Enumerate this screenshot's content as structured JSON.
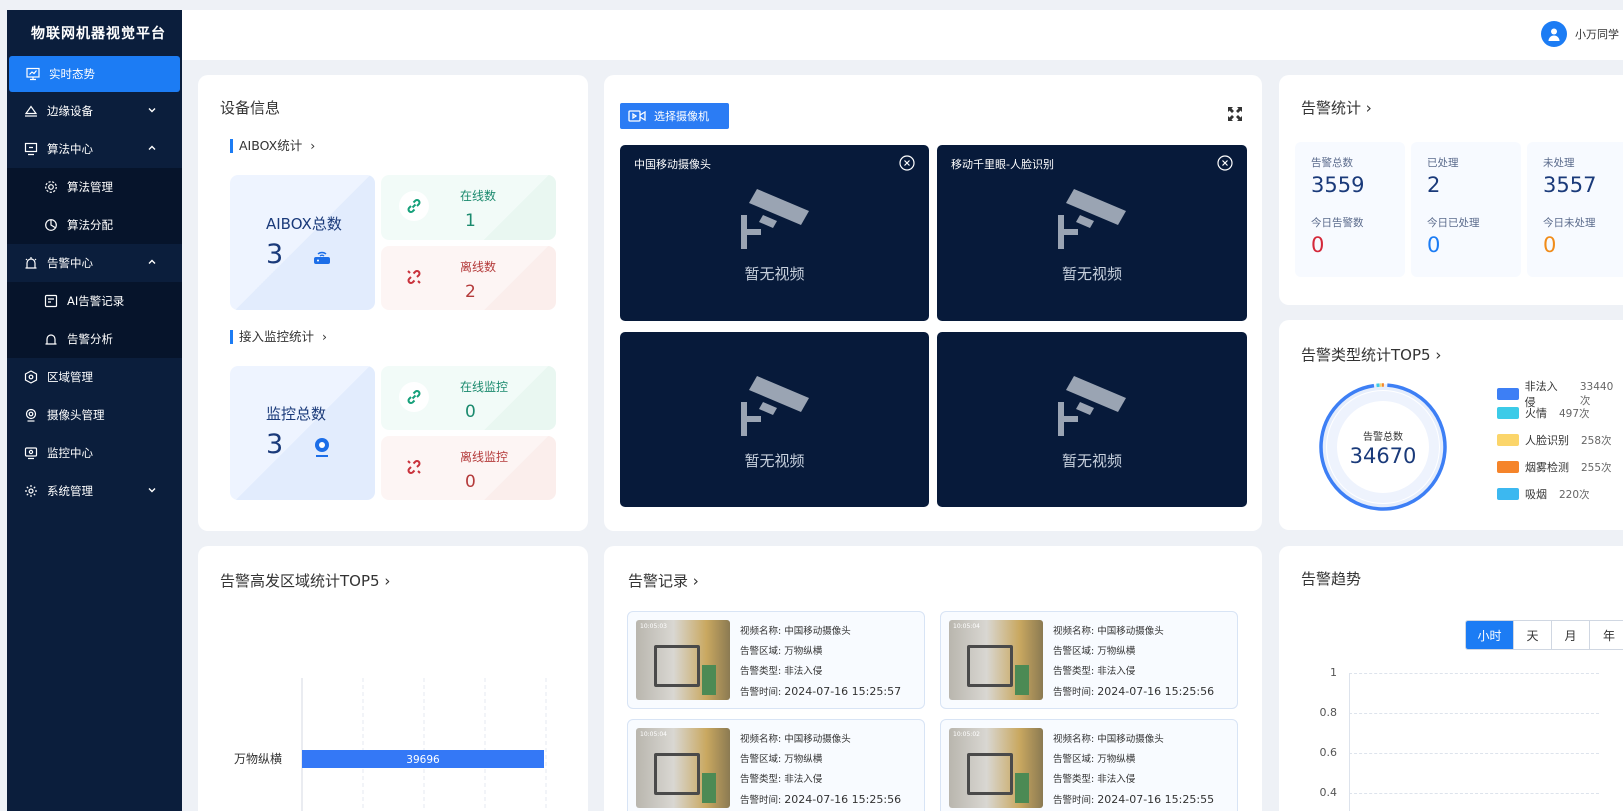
{
  "app": {
    "title": "物联网机器视觉平台"
  },
  "sidebar": {
    "items": [
      {
        "label": "实时态势"
      },
      {
        "label": "边缘设备"
      },
      {
        "label": "算法中心"
      },
      {
        "label": "算法管理"
      },
      {
        "label": "算法分配"
      },
      {
        "label": "告警中心"
      },
      {
        "label": "AI告警记录"
      },
      {
        "label": "告警分析"
      },
      {
        "label": "区域管理"
      },
      {
        "label": "摄像头管理"
      },
      {
        "label": "监控中心"
      },
      {
        "label": "系统管理"
      }
    ]
  },
  "header": {
    "user": "小万同学"
  },
  "device": {
    "title": "设备信息",
    "aibox": {
      "section": "AIBOX统计",
      "total_label": "AIBOX总数",
      "total": "3",
      "online_label": "在线数",
      "online": "1",
      "offline_label": "离线数",
      "offline": "2"
    },
    "monitor": {
      "section": "接入监控统计",
      "total_label": "监控总数",
      "total": "3",
      "online_label": "在线监控",
      "online": "0",
      "offline_label": "离线监控",
      "offline": "0"
    }
  },
  "video": {
    "select_label": "选择摄像机",
    "panels": [
      {
        "title": "中国移动摄像头",
        "empty": "暂无视频"
      },
      {
        "title": "移动千里眼-人脸识别",
        "empty": "暂无视频"
      },
      {
        "title": "",
        "empty": "暂无视频"
      },
      {
        "title": "",
        "empty": "暂无视频"
      }
    ]
  },
  "alarm_stats": {
    "title": "告警统计",
    "boxes": [
      {
        "label": "告警总数",
        "value": "3559",
        "today_label": "今日告警数",
        "today": "0",
        "color": "#d4283a"
      },
      {
        "label": "已处理",
        "value": "2",
        "today_label": "今日已处理",
        "today": "0",
        "color": "#1c7cf4"
      },
      {
        "label": "未处理",
        "value": "3557",
        "today_label": "今日未处理",
        "today": "0",
        "color": "#f08c1a"
      }
    ]
  },
  "alarm_types": {
    "title": "告警类型统计TOP5",
    "center_label": "告警总数",
    "center_value": "34670",
    "legend": [
      {
        "name": "非法入侵",
        "count": "33440次",
        "color": "#3d7ff5"
      },
      {
        "name": "火情",
        "count": "497次",
        "color": "#3ccbe8"
      },
      {
        "name": "人脸识别",
        "count": "258次",
        "color": "#fbd56a"
      },
      {
        "name": "烟雾检测",
        "count": "255次",
        "color": "#f5842a"
      },
      {
        "name": "吸烟",
        "count": "220次",
        "color": "#3cb8f0"
      }
    ]
  },
  "region_top5": {
    "title": "告警高发区域统计TOP5"
  },
  "chart_data": {
    "type": "bar",
    "orientation": "horizontal",
    "categories": [
      "万物纵横"
    ],
    "values": [
      39696
    ]
  },
  "records": {
    "title": "告警记录",
    "labels": {
      "name": "视频名称: ",
      "area": "告警区域: ",
      "type": "告警类型: ",
      "time": "告警时间: "
    },
    "items": [
      {
        "name": "中国移动摄像头",
        "area": "万物纵横",
        "type": "非法入侵",
        "time": "2024-07-16 15:25:57",
        "stamp": "10:05:03"
      },
      {
        "name": "中国移动摄像头",
        "area": "万物纵横",
        "type": "非法入侵",
        "time": "2024-07-16 15:25:56",
        "stamp": "10:05:04"
      },
      {
        "name": "中国移动摄像头",
        "area": "万物纵横",
        "type": "非法入侵",
        "time": "2024-07-16 15:25:56",
        "stamp": "10:05:04"
      },
      {
        "name": "中国移动摄像头",
        "area": "万物纵横",
        "type": "非法入侵",
        "time": "2024-07-16 15:25:55",
        "stamp": "10:05:02"
      }
    ]
  },
  "trend": {
    "title": "告警趋势",
    "ranges": [
      "小时",
      "天",
      "月",
      "年"
    ],
    "ticks": [
      "1",
      "0.8",
      "0.6",
      "0.4"
    ]
  }
}
